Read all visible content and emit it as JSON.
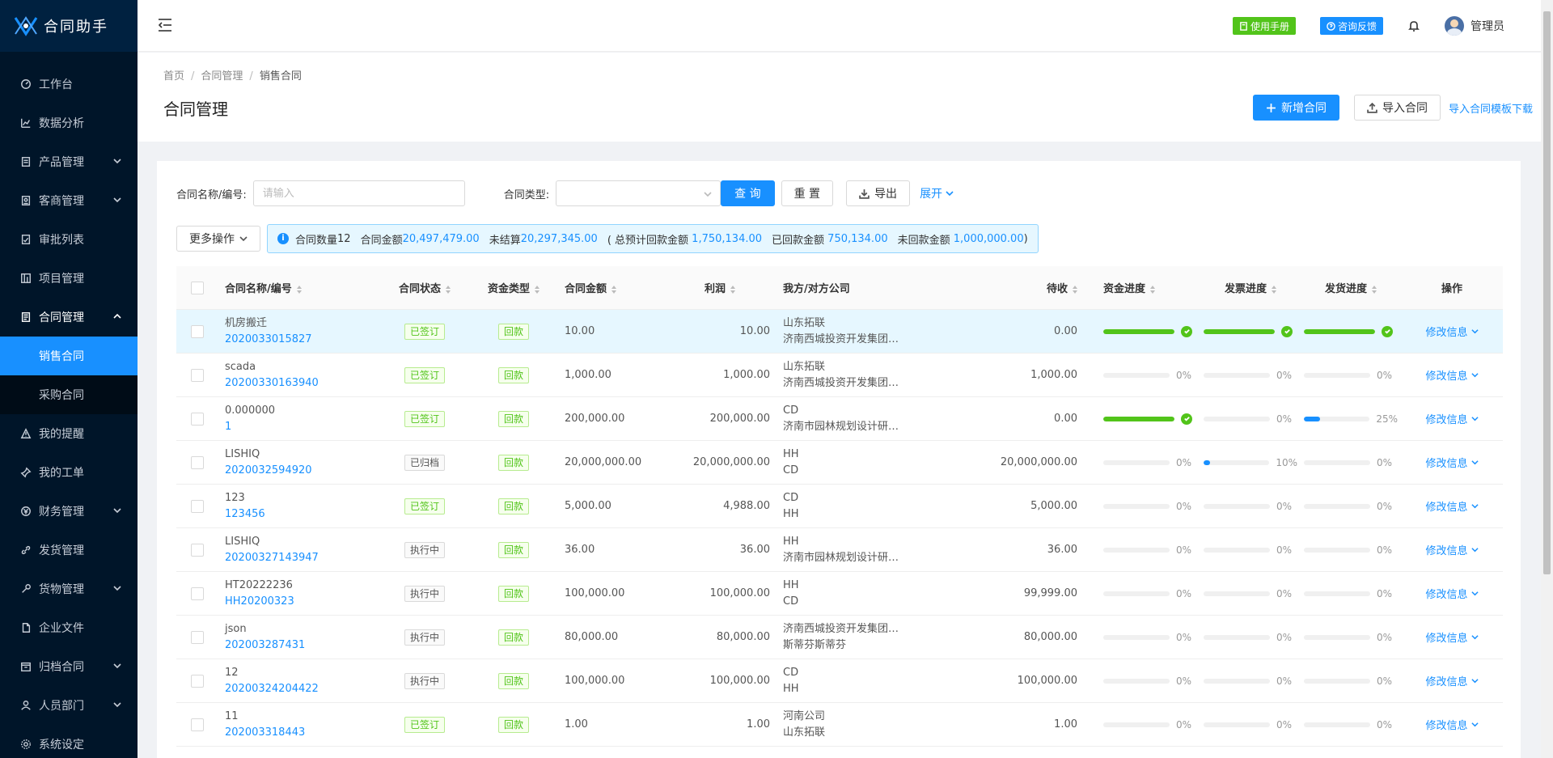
{
  "app": {
    "name": "合同助手"
  },
  "sidebar": {
    "items": [
      {
        "label": "工作台",
        "icon": "dashboard-icon"
      },
      {
        "label": "数据分析",
        "icon": "line-chart-icon"
      },
      {
        "label": "产品管理",
        "icon": "box-icon",
        "has_children": true
      },
      {
        "label": "客商管理",
        "icon": "contacts-icon",
        "has_children": true
      },
      {
        "label": "审批列表",
        "icon": "audit-icon"
      },
      {
        "label": "项目管理",
        "icon": "project-icon"
      },
      {
        "label": "合同管理",
        "icon": "contract-icon",
        "has_children": true,
        "open": true,
        "children": [
          {
            "label": "销售合同",
            "active": true
          },
          {
            "label": "采购合同"
          }
        ]
      },
      {
        "label": "我的提醒",
        "icon": "warning-icon"
      },
      {
        "label": "我的工单",
        "icon": "pin-icon"
      },
      {
        "label": "财务管理",
        "icon": "money-icon",
        "has_children": true
      },
      {
        "label": "发货管理",
        "icon": "link-icon"
      },
      {
        "label": "货物管理",
        "icon": "tool-icon",
        "has_children": true
      },
      {
        "label": "企业文件",
        "icon": "file-icon"
      },
      {
        "label": "归档合同",
        "icon": "archive-icon",
        "has_children": true
      },
      {
        "label": "人员部门",
        "icon": "user-icon",
        "has_children": true
      },
      {
        "label": "系统设定",
        "icon": "gear-icon"
      }
    ]
  },
  "header": {
    "manual_label": "使用手册",
    "feedback_label": "咨询反馈",
    "user_name": "管理员"
  },
  "breadcrumb": [
    "首页",
    "合同管理",
    "销售合同"
  ],
  "page": {
    "title": "合同管理",
    "add_label": "新增合同",
    "import_label": "导入合同",
    "template_label": "导入合同模板下载"
  },
  "filter": {
    "name_label": "合同名称/编号:",
    "name_placeholder": "请输入",
    "type_label": "合同类型:",
    "query_label": "查 询",
    "reset_label": "重 置",
    "export_label": "导出",
    "expand_label": "展开"
  },
  "more_ops_label": "更多操作",
  "summary": {
    "count_label": "合同数量",
    "count": "12",
    "amount_label": "合同金额",
    "amount": "20,497,479.00",
    "unsettled_label": "未结算",
    "unsettled": "20,297,345.00",
    "expected_label": "( 总预计回款金额",
    "expected": "1,750,134.00",
    "received_label": "已回款金额",
    "received": "750,134.00",
    "unreceived_label": "未回款金额",
    "unreceived": "1,000,000.00",
    "close": ")"
  },
  "table": {
    "columns": {
      "name": "合同名称/编号",
      "status": "合同状态",
      "ftype": "资金类型",
      "amount": "合同金额",
      "profit": "利润",
      "company": "我方/对方公司",
      "pending": "待收",
      "fund_progress": "资金进度",
      "invoice_progress": "发票进度",
      "ship_progress": "发货进度",
      "op": "操作"
    },
    "op_label": "修改信息",
    "rows": [
      {
        "name": "机房搬迁",
        "code": "2020033015827",
        "status": "已签订",
        "status_kind": "green",
        "ftype": "回款",
        "amount": "10.00",
        "profit": "10.00",
        "our": "山东拓联",
        "their": "济南西城投资开发集团…",
        "pending": "0.00",
        "fund": 100,
        "invoice": 100,
        "ship": 100,
        "fund_text": "",
        "invoice_text": "",
        "ship_text": "",
        "hover": true
      },
      {
        "name": "scada",
        "code": "20200330163940",
        "status": "已签订",
        "status_kind": "green",
        "ftype": "回款",
        "amount": "1,000.00",
        "profit": "1,000.00",
        "our": "山东拓联",
        "their": "济南西城投资开发集团…",
        "pending": "1,000.00",
        "fund": 0,
        "invoice": 0,
        "ship": 0,
        "fund_text": "0%",
        "invoice_text": "0%",
        "ship_text": "0%"
      },
      {
        "name": "0.000000",
        "code": "1",
        "status": "已签订",
        "status_kind": "green",
        "ftype": "回款",
        "amount": "200,000.00",
        "profit": "200,000.00",
        "our": "CD",
        "their": "济南市园林规划设计研…",
        "pending": "0.00",
        "fund": 100,
        "invoice": 0,
        "ship": 25,
        "fund_text": "",
        "invoice_text": "0%",
        "ship_text": "25%"
      },
      {
        "name": "LISHIQ",
        "code": "2020032594920",
        "status": "已归档",
        "status_kind": "gray",
        "ftype": "回款",
        "amount": "20,000,000.00",
        "profit": "20,000,000.00",
        "our": "HH",
        "their": "CD",
        "pending": "20,000,000.00",
        "fund": 0,
        "invoice": 10,
        "ship": 0,
        "fund_text": "0%",
        "invoice_text": "10%",
        "ship_text": "0%"
      },
      {
        "name": "123",
        "code": "123456",
        "status": "已签订",
        "status_kind": "green",
        "ftype": "回款",
        "amount": "5,000.00",
        "profit": "4,988.00",
        "our": "CD",
        "their": "HH",
        "pending": "5,000.00",
        "fund": 0,
        "invoice": 0,
        "ship": 0,
        "fund_text": "0%",
        "invoice_text": "0%",
        "ship_text": "0%"
      },
      {
        "name": "LISHIQ",
        "code": "2020032714394​7",
        "status": "执行中",
        "status_kind": "gray",
        "ftype": "回款",
        "amount": "36.00",
        "profit": "36.00",
        "our": "HH",
        "their": "济南市园林规划设计研…",
        "pending": "36.00",
        "fund": 0,
        "invoice": 0,
        "ship": 0,
        "fund_text": "0%",
        "invoice_text": "0%",
        "ship_text": "0%"
      },
      {
        "name": "HT20222236",
        "code": "HH20200323",
        "status": "执行中",
        "status_kind": "gray",
        "ftype": "回款",
        "amount": "100,000.00",
        "profit": "100,000.00",
        "our": "HH",
        "their": "CD",
        "pending": "99,999.00",
        "fund": 0,
        "invoice": 0,
        "ship": 0,
        "fund_text": "0%",
        "invoice_text": "0%",
        "ship_text": "0%"
      },
      {
        "name": "json",
        "code": "202003287431",
        "status": "执行中",
        "status_kind": "gray",
        "ftype": "回款",
        "amount": "80,000.00",
        "profit": "80,000.00",
        "our": "济南西城投资开发集团…",
        "their": "斯蒂芬斯蒂芬",
        "pending": "80,000.00",
        "fund": 0,
        "invoice": 0,
        "ship": 0,
        "fund_text": "0%",
        "invoice_text": "0%",
        "ship_text": "0%"
      },
      {
        "name": "12",
        "code": "20200324204422",
        "status": "执行中",
        "status_kind": "gray",
        "ftype": "回款",
        "amount": "100,000.00",
        "profit": "100,000.00",
        "our": "CD",
        "their": "HH",
        "pending": "100,000.00",
        "fund": 0,
        "invoice": 0,
        "ship": 0,
        "fund_text": "0%",
        "invoice_text": "0%",
        "ship_text": "0%"
      },
      {
        "name": "11",
        "code": "202003318443",
        "status": "已签订",
        "status_kind": "green",
        "ftype": "回款",
        "amount": "1.00",
        "profit": "1.00",
        "our": "河南公司",
        "their": "山东拓联",
        "pending": "1.00",
        "fund": 0,
        "invoice": 0,
        "ship": 0,
        "fund_text": "0%",
        "invoice_text": "0%",
        "ship_text": "0%"
      }
    ]
  }
}
